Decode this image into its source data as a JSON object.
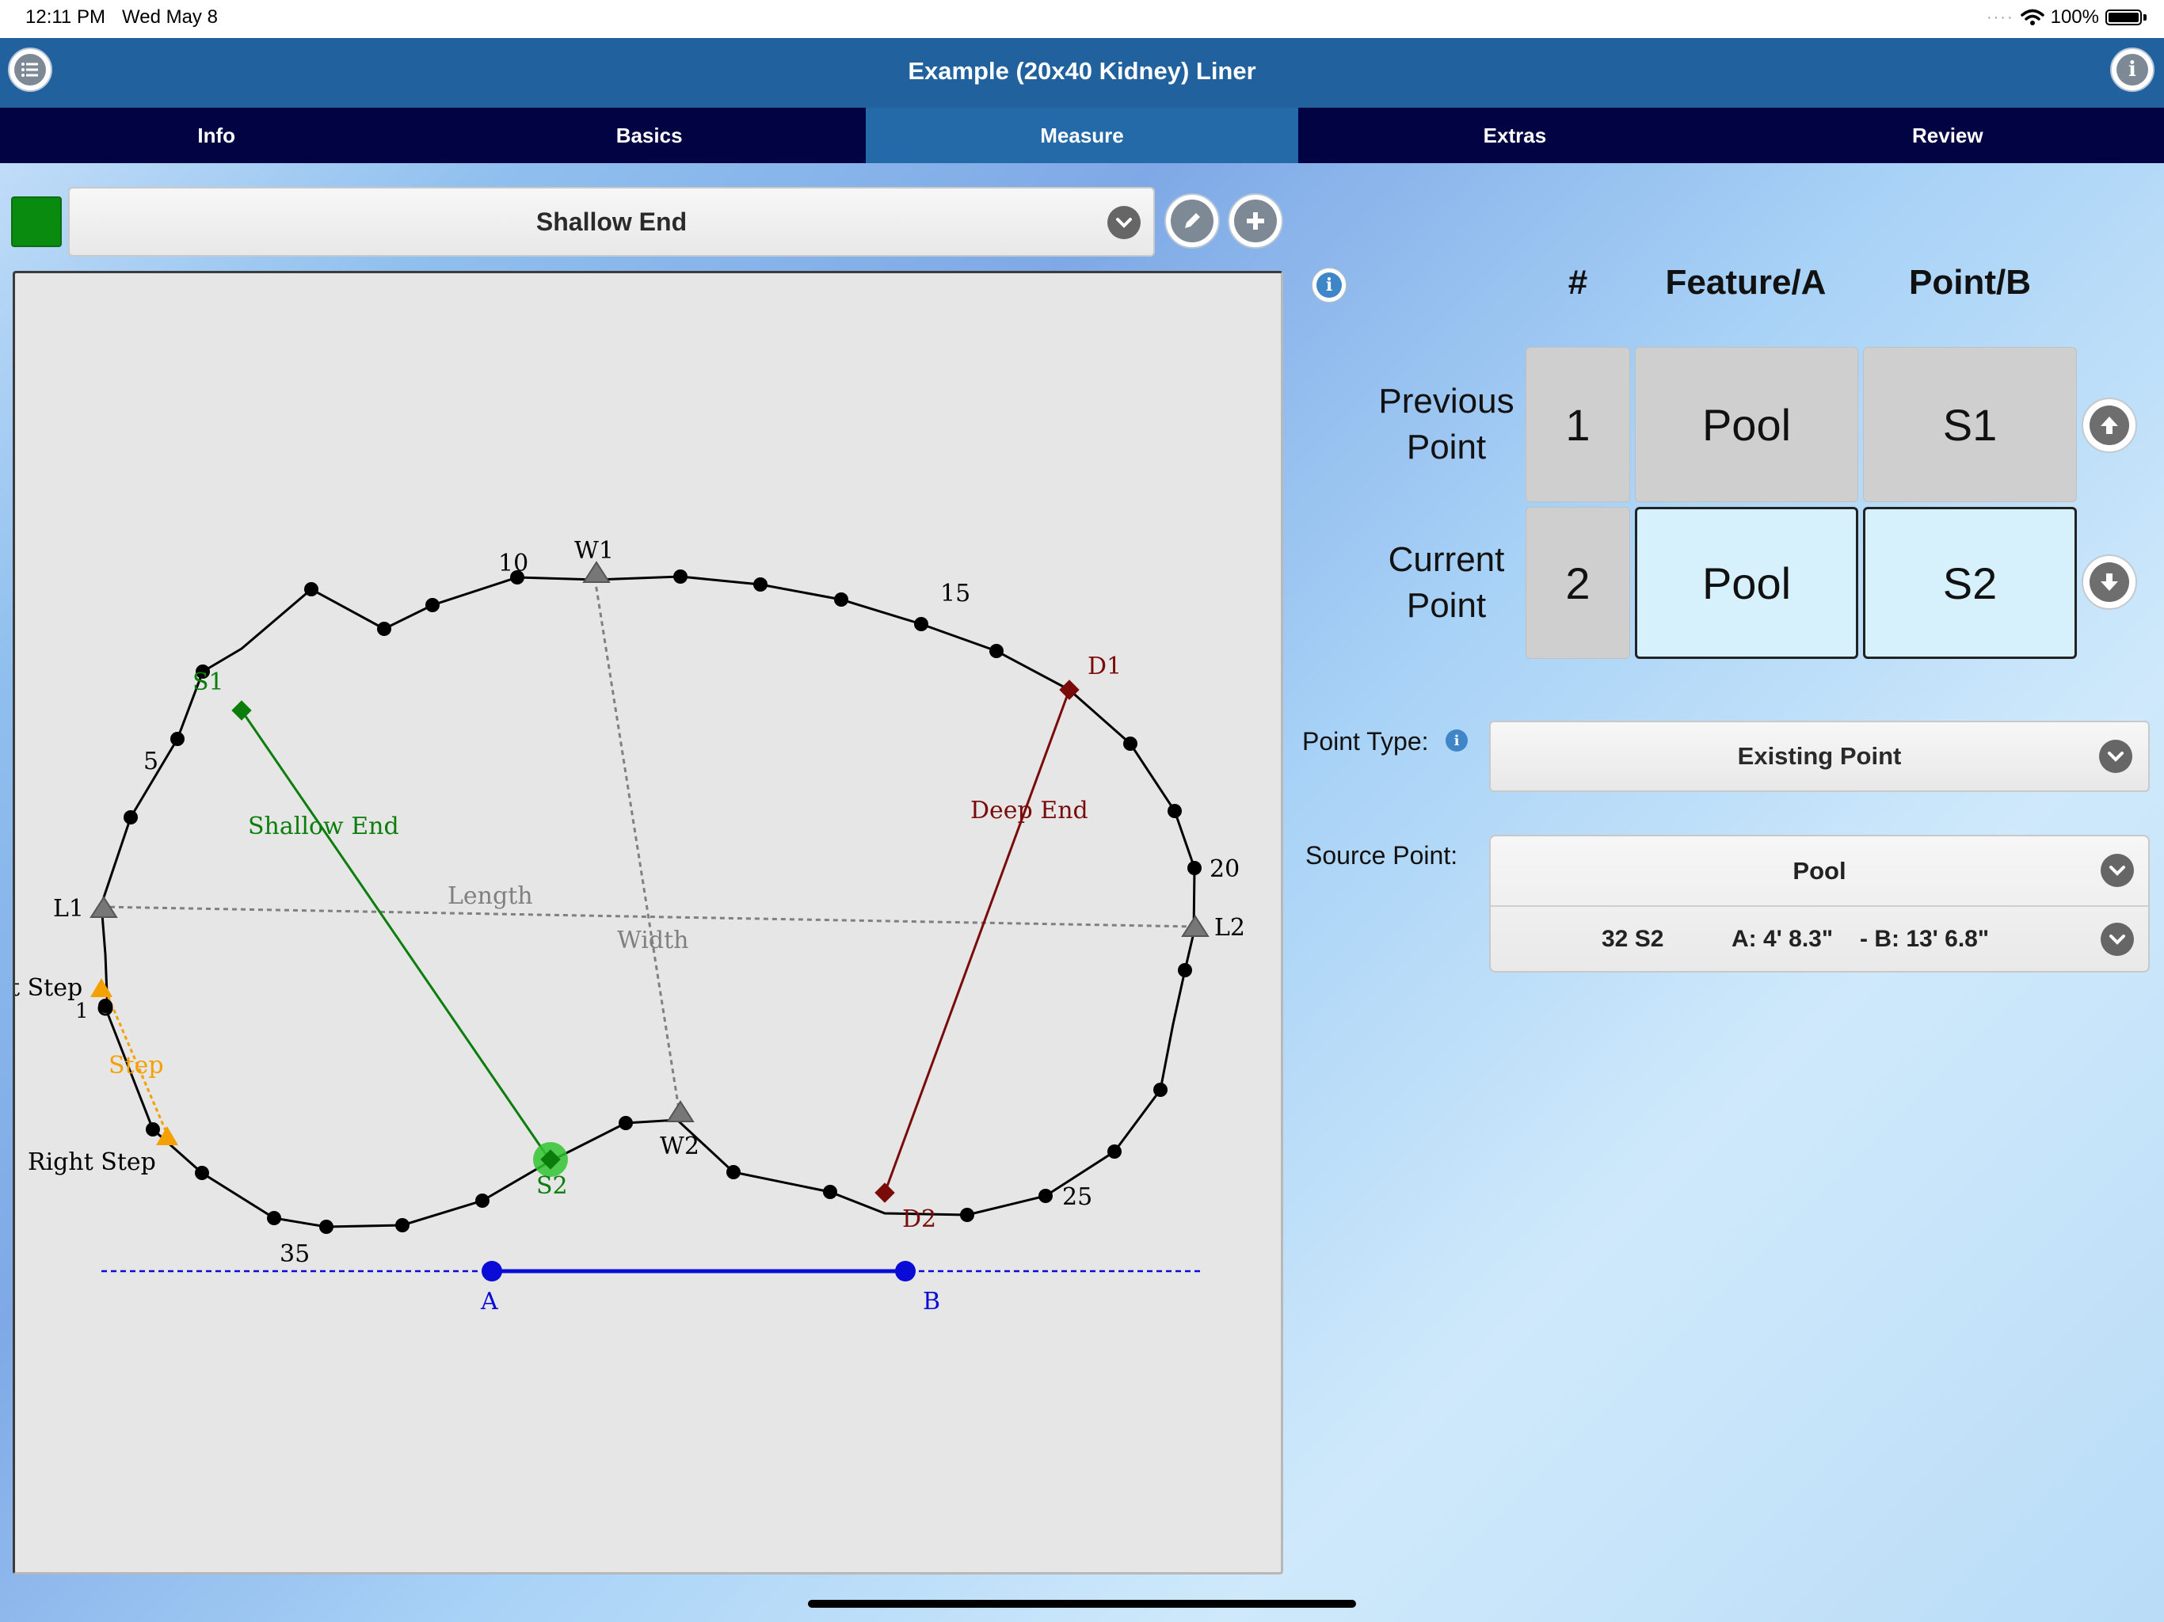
{
  "status": {
    "time": "12:11 PM",
    "date": "Wed May 8",
    "battery": "100%"
  },
  "header": {
    "title": "Example (20x40 Kidney) Liner"
  },
  "tabs": [
    {
      "label": "Info",
      "active": false
    },
    {
      "label": "Basics",
      "active": false
    },
    {
      "label": "Measure",
      "active": true
    },
    {
      "label": "Extras",
      "active": false
    },
    {
      "label": "Review",
      "active": false
    }
  ],
  "feature": {
    "color": "#098b0f",
    "selected": "Shallow End"
  },
  "drawing": {
    "labels": {
      "n10": "10",
      "n15": "15",
      "n5": "5",
      "n20": "20",
      "n25": "25",
      "n35": "35",
      "n1": "1",
      "w1": "W1",
      "w2": "W2",
      "s1": "S1",
      "s2": "S2",
      "d1": "D1",
      "d2": "D2",
      "l1": "L1",
      "l2": "L2",
      "shallow_end": "Shallow End",
      "deep_end": "Deep End",
      "length": "Length",
      "width": "Width",
      "step": "Step",
      "right_step": "Right Step",
      "left_step": "t Step",
      "a": "A",
      "b": "B"
    }
  },
  "table": {
    "headers": {
      "num": "#",
      "feature": "Feature/A",
      "point": "Point/B"
    },
    "rows": [
      {
        "label_line1": "Previous",
        "label_line2": "Point",
        "num": "1",
        "feature": "Pool",
        "point": "S1"
      },
      {
        "label_line1": "Current",
        "label_line2": "Point",
        "num": "2",
        "feature": "Pool",
        "point": "S2"
      }
    ]
  },
  "form": {
    "point_type_label": "Point Type:",
    "point_type_value": "Existing Point",
    "source_point_label": "Source Point:",
    "source_point_value": "Pool",
    "source_point_detail_id": "32 S2",
    "source_point_detail_a": "A: 4' 8.3\"",
    "source_point_detail_b": "- B: 13' 6.8\""
  },
  "colors": {
    "title_bar": "#20619e",
    "tab_bar": "#020343",
    "tab_active": "#246aa9",
    "shallow": "#0a7d0a",
    "deep": "#7a0b0b",
    "guide": "#808080",
    "step": "#f3a000",
    "measure": "#0b0bd8"
  }
}
